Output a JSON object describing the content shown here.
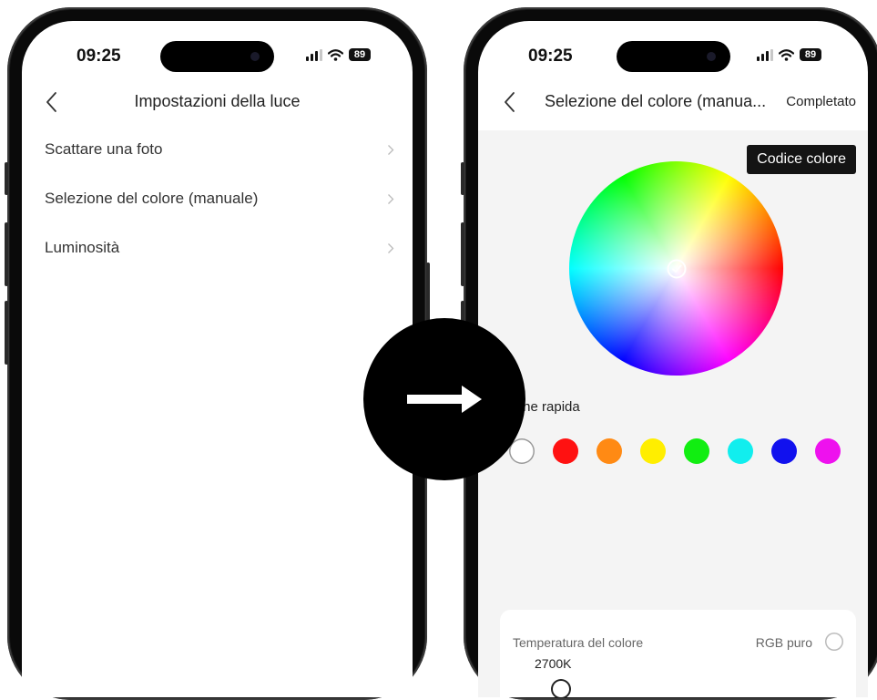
{
  "left_screen": {
    "status": {
      "time": "09:25",
      "battery": "89"
    },
    "title": "Impostazioni della luce",
    "menu_items": [
      {
        "label": "Scattare una foto"
      },
      {
        "label": "Selezione del colore (manuale)"
      },
      {
        "label": "Luminosità"
      }
    ]
  },
  "right_screen": {
    "status": {
      "time": "09:25",
      "battery": "89"
    },
    "title": "Selezione del colore (manua...",
    "done_label": "Completato",
    "code_button_label": "Codice colore",
    "quick_selection_label": "zione rapida",
    "swatches": [
      {
        "name": "white",
        "color": "#ffffff"
      },
      {
        "name": "red",
        "color": "#ff1111"
      },
      {
        "name": "orange",
        "color": "#ff8a14"
      },
      {
        "name": "yellow",
        "color": "#ffee00"
      },
      {
        "name": "green",
        "color": "#11ee11"
      },
      {
        "name": "cyan",
        "color": "#11eeee"
      },
      {
        "name": "blue",
        "color": "#1111ee"
      },
      {
        "name": "magenta",
        "color": "#ee11ee"
      }
    ],
    "temperature_label": "Temperatura del colore",
    "rgb_label": "RGB puro",
    "temperature_value": "2700K"
  },
  "icons": {
    "back": "chevron-left-icon",
    "menu_chevron": "chevron-right-icon",
    "transition": "arrow-right-icon",
    "wheel_marker": "check-circle-icon"
  },
  "colors": {
    "frame": "#1b1b1b",
    "content_background": "#f4f4f4",
    "code_button_background": "#141414",
    "arrow_circle": "#000000"
  }
}
